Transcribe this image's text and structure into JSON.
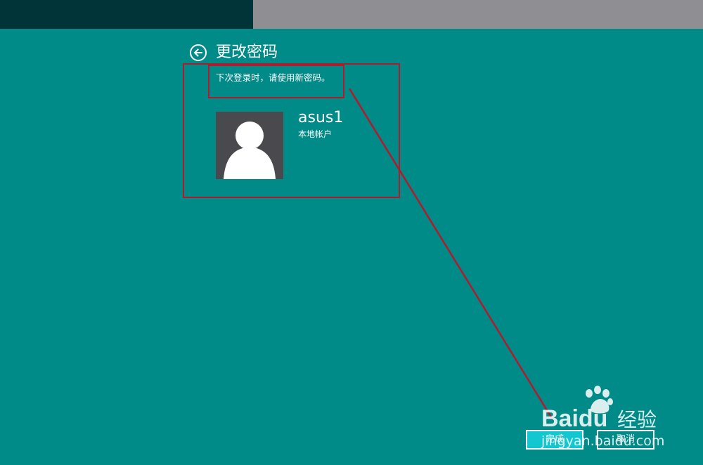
{
  "header": {
    "title": "更改密码",
    "back_icon": "back-arrow-icon"
  },
  "content": {
    "instruction": "下次登录时，请使用新密码。",
    "account": {
      "name": "asus1",
      "type": "本地帐户",
      "avatar_icon": "user-silhouette-icon"
    }
  },
  "actions": {
    "finish_label": "完成",
    "cancel_label": "取消"
  },
  "watermark": {
    "brand": "Baidu",
    "brand_cn": "经验",
    "url": "jingyan.baidu.com"
  },
  "colors": {
    "background": "#008a88",
    "top_left_bar": "#003438",
    "top_right_bar": "#8e8e93",
    "avatar_bg": "#4a4a4e",
    "primary_button": "#12c7cf",
    "annotation": "#b01c2e"
  }
}
